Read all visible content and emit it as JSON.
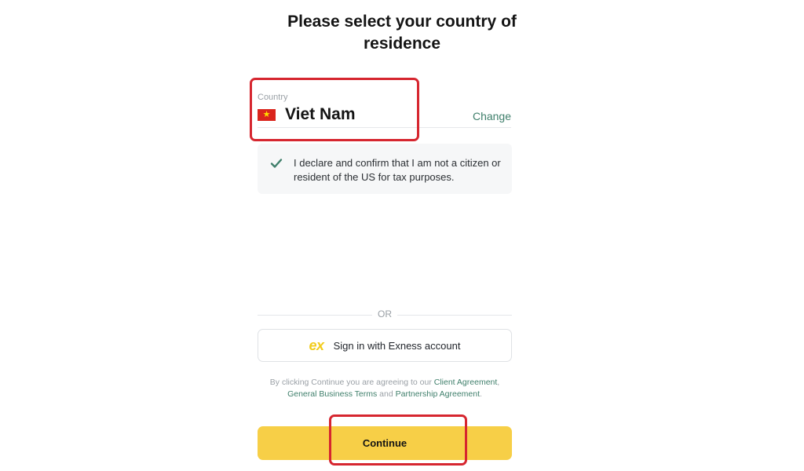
{
  "header": {
    "title_line1": "Please select your country of",
    "title_line2": "residence"
  },
  "country_field": {
    "label": "Country",
    "value": "Viet Nam",
    "flag_icon": "vietnam-flag-icon",
    "change_label": "Change"
  },
  "declaration": {
    "checked": true,
    "text": "I declare and confirm that I am not a citizen or resident of the US for tax purposes."
  },
  "divider": {
    "label": "OR"
  },
  "signin": {
    "logo_text": "ex",
    "label": "Sign in with Exness account"
  },
  "legal": {
    "prefix": "By clicking Continue you are agreeing to our ",
    "link1": "Client Agreement",
    "sep1": ", ",
    "link2": "General Business Terms",
    "sep2": " and ",
    "link3": "Partnership Agreement",
    "suffix": "."
  },
  "continue_button": {
    "label": "Continue"
  },
  "colors": {
    "accent_yellow": "#f7cf47",
    "link_green": "#3f7f6b",
    "annotation_red": "#d6262f",
    "flag_red": "#da251d",
    "flag_star": "#ffde00"
  }
}
